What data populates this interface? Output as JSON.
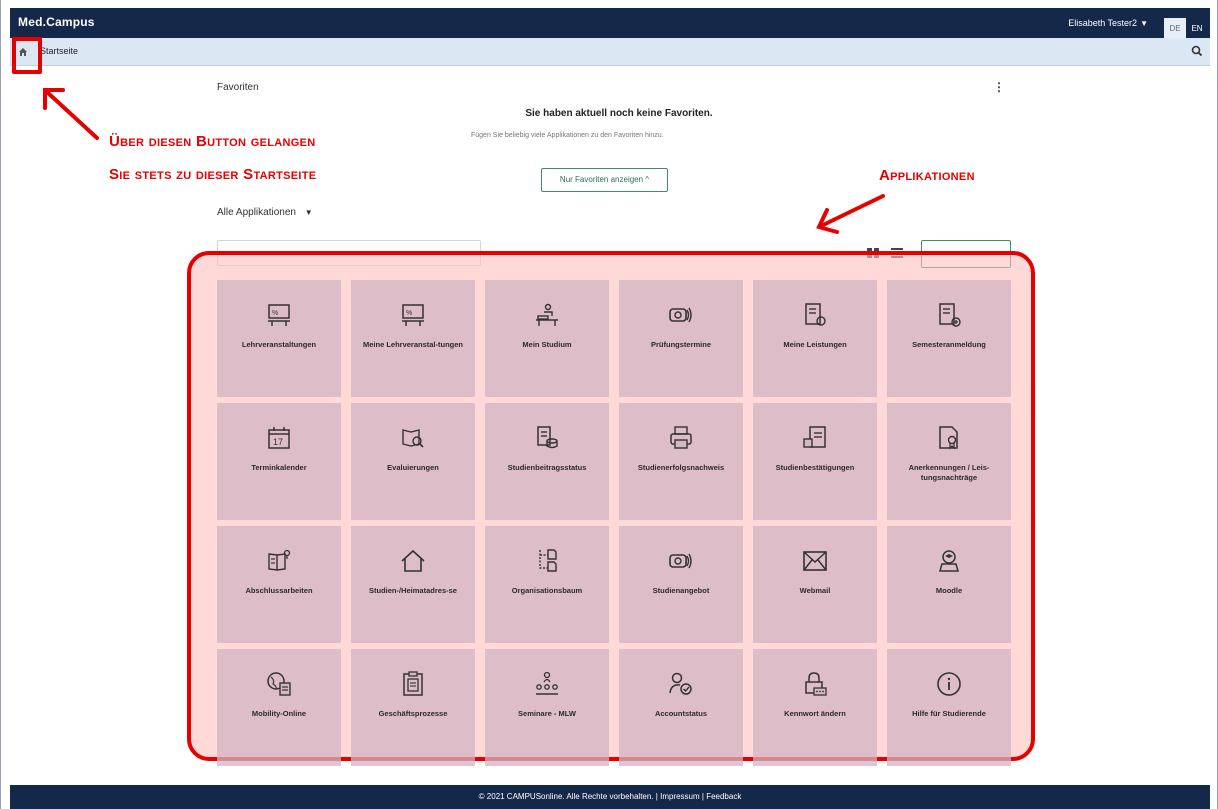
{
  "topbar": {
    "brand": "Med.Campus",
    "user_name": "Elisabeth Tester2",
    "lang_de": "DE",
    "lang_en": "EN"
  },
  "breadcrumb": {
    "home_icon": "home-icon",
    "current": "Startseite",
    "search_icon": "search-icon"
  },
  "favorites": {
    "title": "Favoriten",
    "menu_icon": "kebab-icon",
    "empty_title": "Sie haben aktuell noch keine Favoriten.",
    "empty_hint": "Fügen Sie beliebig viele Applikationen zu den Favoriten hinzu.",
    "toggle_label": "Nur Favoriten anzeigen ^"
  },
  "applications": {
    "dropdown_label": "Alle Applikationen",
    "tiles": [
      {
        "label": "Lehrveranstaltungen",
        "icon": "lecture-icon"
      },
      {
        "label": "Meine Lehrveranstal-tungen",
        "icon": "lecture-icon"
      },
      {
        "label": "Mein Studium",
        "icon": "study-desk-icon"
      },
      {
        "label": "Prüfungstermine",
        "icon": "exam-icon"
      },
      {
        "label": "Meine Leistungen",
        "icon": "grades-icon"
      },
      {
        "label": "Semesteranmeldung",
        "icon": "semester-registration-icon"
      },
      {
        "label": "Terminkalender",
        "icon": "calendar-icon"
      },
      {
        "label": "Evaluierungen",
        "icon": "evaluation-icon"
      },
      {
        "label": "Studienbeitragsstatus",
        "icon": "fee-status-icon"
      },
      {
        "label": "Studienerfolgsnachweis",
        "icon": "printer-icon"
      },
      {
        "label": "Studienbestätigungen",
        "icon": "certificate-icon"
      },
      {
        "label": "Anerkennungen / Leis-tungsnachträge",
        "icon": "recognition-icon"
      },
      {
        "label": "Abschlussarbeiten",
        "icon": "thesis-icon"
      },
      {
        "label": "Studien-/Heimatadres-se",
        "icon": "house-icon"
      },
      {
        "label": "Organisationsbaum",
        "icon": "org-tree-icon"
      },
      {
        "label": "Studienangebot",
        "icon": "course-offer-icon"
      },
      {
        "label": "Webmail",
        "icon": "mail-icon"
      },
      {
        "label": "Moodle",
        "icon": "moodle-icon"
      },
      {
        "label": "Mobility-Online",
        "icon": "globe-icon"
      },
      {
        "label": "Geschäftsprozesse",
        "icon": "clipboard-icon"
      },
      {
        "label": "Seminare - MLW",
        "icon": "seminar-icon"
      },
      {
        "label": "Accountstatus",
        "icon": "account-status-icon"
      },
      {
        "label": "Kennwort ändern",
        "icon": "lock-icon"
      },
      {
        "label": "Hilfe für Studierende",
        "icon": "info-icon"
      }
    ]
  },
  "annotations": {
    "home_line1": "Über diesen Button gelangen",
    "home_line2": "Sie stets zu dieser Startseite",
    "apps": "Applikationen"
  },
  "footer": {
    "copyright": "© 2021 CAMPUSonline. Alle Rechte vorbehalten.",
    "sep": " | ",
    "impressum": "Impressum",
    "feedback": "Feedback"
  },
  "colors": {
    "topbar": "#14284a",
    "accent": "#3a8c6a",
    "annotation": "#e60000"
  }
}
